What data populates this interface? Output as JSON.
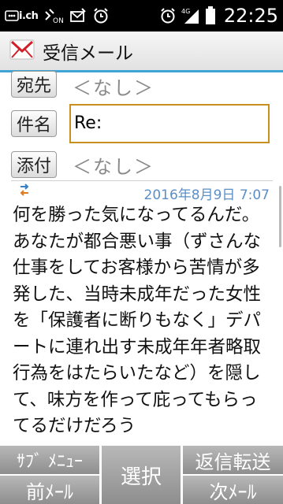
{
  "status_bar": {
    "carrier_icon_text": "i.ch",
    "time": "22:25",
    "icons": [
      "ichannel-icon",
      "alarm-on-icon",
      "mail-notify-icon",
      "alarm-clock-icon",
      "alarm-clock-icon",
      "signal-4g-icon",
      "battery-icon"
    ]
  },
  "title_bar": {
    "icon": "mail-icon",
    "title": "受信メール"
  },
  "header": {
    "to_label": "宛先",
    "to_value": "＜なし＞",
    "subject_label": "件名",
    "subject_value": "Re:",
    "attach_label": "添付",
    "attach_value": "＜なし＞"
  },
  "message": {
    "direction_icon": "send-receive-arrows-icon",
    "date": "2016年8月9日 7:07",
    "paragraphs": [
      "何を勝った気になってるんだ。",
      "あなたが都合悪い事（ずさんな仕事をしてお客様から苦情が多発した、当時未成年だった女性を「保護者に断りもなく」デパートに連れ出す未成年年者略取行為をはたらいたなど）を隠して、味方を作って庇ってもらってるだけだろう"
    ]
  },
  "softkeys": {
    "submenu": "ｻﾌﾞ ﾒﾆｭｰ",
    "prev": "前ﾒｰﾙ",
    "select": "選択",
    "reply_forward": "返信転送",
    "next": "次ﾒｰﾙ"
  },
  "colors": {
    "title_accent": "#3ea4d6",
    "subject_focus_border": "#c8901e",
    "date_text": "#5b8fc7",
    "softkey_bg": "#a3a3a3"
  }
}
